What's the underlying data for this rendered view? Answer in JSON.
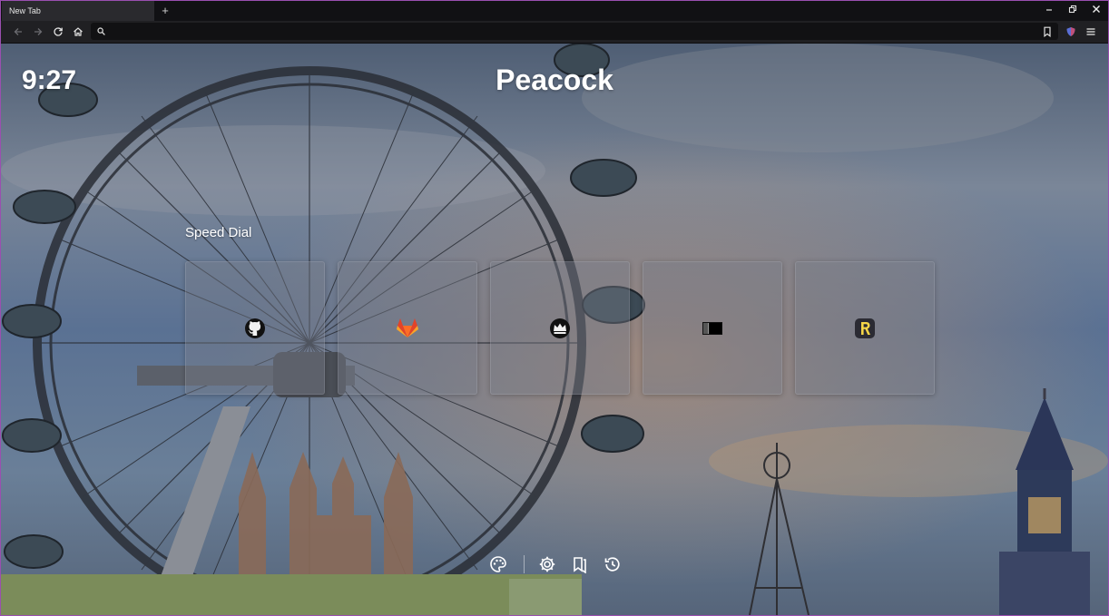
{
  "tabs": [
    {
      "title": "New Tab"
    }
  ],
  "toolbar": {
    "address_value": "",
    "address_placeholder": ""
  },
  "page": {
    "clock": "9:27",
    "brand": "Peacock",
    "speed_dial_title": "Speed Dial",
    "speed_dial_tiles": [
      {
        "icon": "github-icon"
      },
      {
        "icon": "gitlab-icon"
      },
      {
        "icon": "crown-icon"
      },
      {
        "icon": "barcode-icon"
      },
      {
        "icon": "r-logo-icon"
      }
    ],
    "bottom_actions": [
      "palette-icon",
      "settings-icon",
      "bookmarks-icon",
      "history-icon"
    ]
  },
  "colors": {
    "accent_frame": "#9a4fb0",
    "tab_bg": "#2a2a2e",
    "toolbar_bg": "#202023",
    "gitlab_orange": "#e24329",
    "r_logo_yellow": "#f5d547"
  }
}
